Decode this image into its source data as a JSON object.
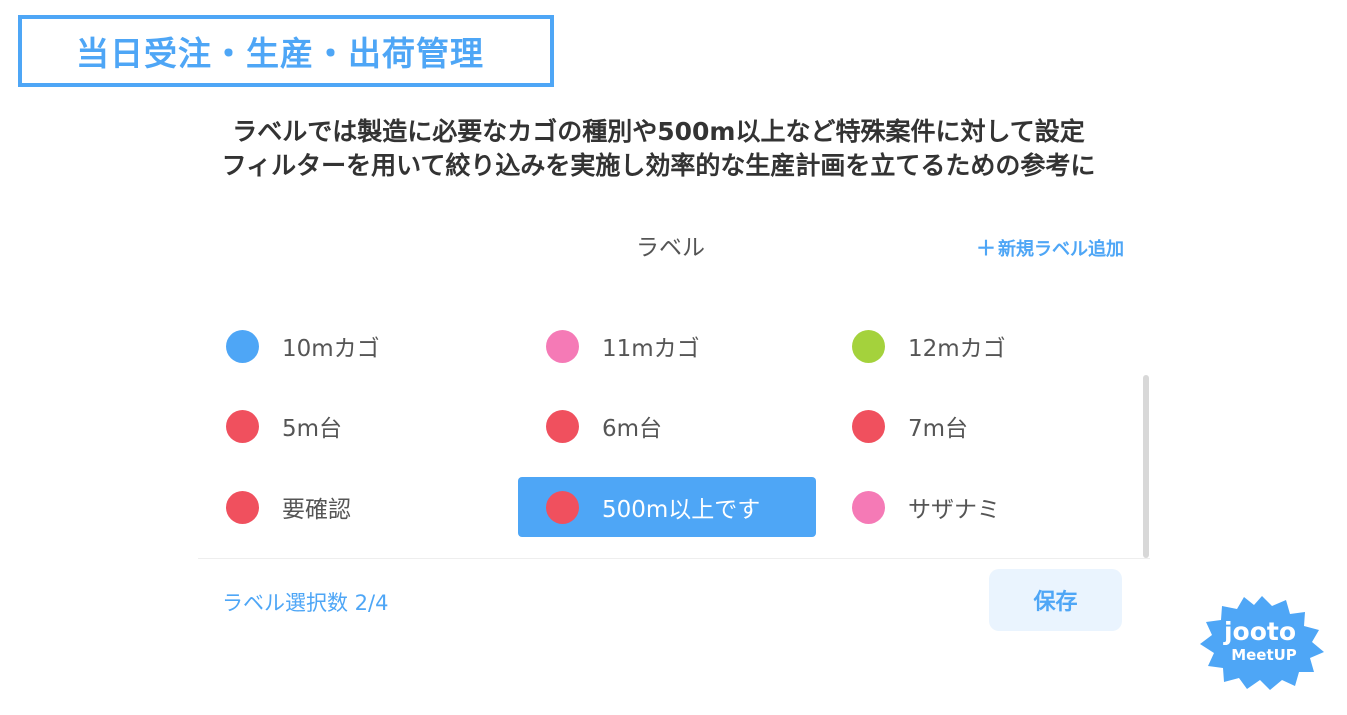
{
  "slide": {
    "title": "当日受注・生産・出荷管理",
    "subtitle_line1": "ラベルでは製造に必要なカゴの種別や500m以上など特殊案件に対して設定",
    "subtitle_line2": "フィルターを用いて絞り込みを実施し効率的な生産計画を立てるための参考に"
  },
  "panel": {
    "title": "ラベル",
    "add_label": "新規ラベル追加",
    "add_label_icon": "plus-icon",
    "labels": [
      {
        "name": "10mカゴ",
        "color": "#4ea6f6",
        "selected": false
      },
      {
        "name": "11mカゴ",
        "color": "#f57ab6",
        "selected": false
      },
      {
        "name": "12mカゴ",
        "color": "#a4d23c",
        "selected": false
      },
      {
        "name": "5m台",
        "color": "#f0505e",
        "selected": false
      },
      {
        "name": "6m台",
        "color": "#f0505e",
        "selected": false
      },
      {
        "name": "7m台",
        "color": "#f0505e",
        "selected": false
      },
      {
        "name": "要確認",
        "color": "#f0505e",
        "selected": false
      },
      {
        "name": "500m以上です",
        "color": "#f0505e",
        "selected": true
      },
      {
        "name": "サザナミ",
        "color": "#f57ab6",
        "selected": false
      }
    ],
    "selection_count": "ラベル選択数 2/4",
    "save_label": "保存"
  },
  "logo": {
    "text_main": "jooto",
    "text_sub": "MeetUP",
    "color": "#4ea6f6"
  },
  "colors": {
    "accent": "#4ea6f6",
    "selected_bg": "#4ea6f6"
  }
}
